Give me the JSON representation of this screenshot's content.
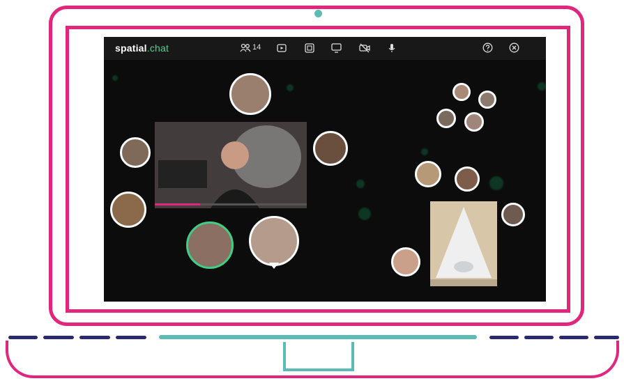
{
  "app": {
    "brand_primary": "spatial",
    "brand_accent": ".chat",
    "participant_count": "14"
  },
  "toolbar": {
    "icons": [
      "people-icon",
      "play-icon",
      "media-share-icon",
      "screen-share-icon",
      "camera-off-icon",
      "mic-icon",
      "help-icon",
      "close-icon"
    ]
  },
  "colors": {
    "frame_pink": "#e0267d",
    "teal": "#5bbcb6",
    "navy": "#2a2a6f",
    "screen_bg": "#0c0c0c",
    "accent_green": "#4fd18b"
  }
}
